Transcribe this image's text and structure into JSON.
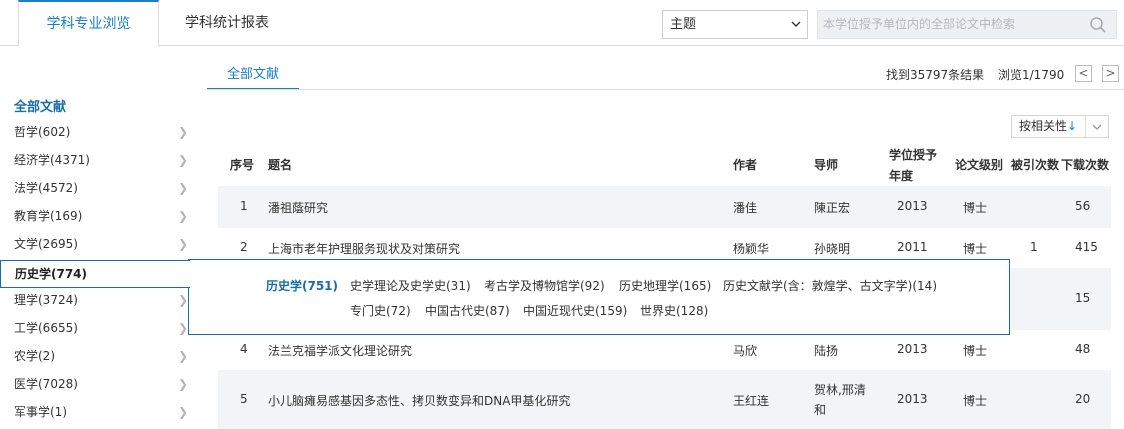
{
  "tabs": {
    "active": "学科专业浏览",
    "inactive": "学科统计报表"
  },
  "search": {
    "scope": "主题",
    "placeholder": "本学位授予单位内的全部论文中检索"
  },
  "sidebar": {
    "all_label": "全部文献",
    "items": [
      "哲学(602)",
      "经济学(4371)",
      "法学(4572)",
      "教育学(169)",
      "文学(2695)",
      "历史学(774)",
      "理学(3724)",
      "工学(6655)",
      "农学(2)",
      "医学(7028)",
      "军事学(1)"
    ]
  },
  "panel": {
    "tab": "全部文献",
    "found": "找到35797条结果",
    "browse": "浏览1/1790",
    "prev": "<",
    "next": ">",
    "sort_label": "按相关性",
    "sort_arrow": "↓"
  },
  "table": {
    "headers": [
      "序号",
      "题名",
      "作者",
      "导师",
      "学位授予",
      "年度",
      "论文级别",
      "被引次数",
      "下载次数"
    ],
    "rows": [
      {
        "no": "1",
        "title": "潘祖蔭研究",
        "author": "潘佳",
        "advisor": "陳正宏",
        "year": "2013",
        "level": "博士",
        "cited": "",
        "downloads": "56"
      },
      {
        "no": "2",
        "title": "上海市老年护理服务现状及对策研究",
        "author": "杨颖华",
        "advisor": "孙晓明",
        "year": "2011",
        "level": "博士",
        "cited": "1",
        "downloads": "415"
      },
      {
        "no": "",
        "title": "",
        "author": "",
        "advisor": "",
        "year": "",
        "level": "",
        "cited": "",
        "downloads": "15"
      },
      {
        "no": "4",
        "title": "法兰克福学派文化理论研究",
        "author": "马欣",
        "advisor": "陆扬",
        "year": "2013",
        "level": "博士",
        "cited": "",
        "downloads": "48"
      },
      {
        "no": "5",
        "title": "小儿脑瘫易感基因多态性、拷贝数变异和DNA甲基化研究",
        "author": "王红连",
        "advisor": "贺林,邢清",
        "advisor2": "和",
        "year": "2013",
        "level": "博士",
        "cited": "",
        "downloads": "20"
      }
    ]
  },
  "popup": {
    "main": "历史学(751)",
    "line1": [
      "史学理论及史学史(31)",
      "考古学及博物馆学(92)",
      "历史地理学(165)",
      "历史文献学(含：敦煌学、古文字学)(14)"
    ],
    "line2": [
      "专门史(72)",
      "中国古代史(87)",
      "中国近现代史(159)",
      "世界史(128)"
    ]
  },
  "colors": {
    "accent": "#1a7fc9",
    "border_blue": "#1a6ea8",
    "row_alt": "#f3f4f7"
  },
  "icons": {
    "search": "magnifier-icon",
    "chevron": "chevron-down-icon",
    "arrow": "chevron-right-icon"
  }
}
